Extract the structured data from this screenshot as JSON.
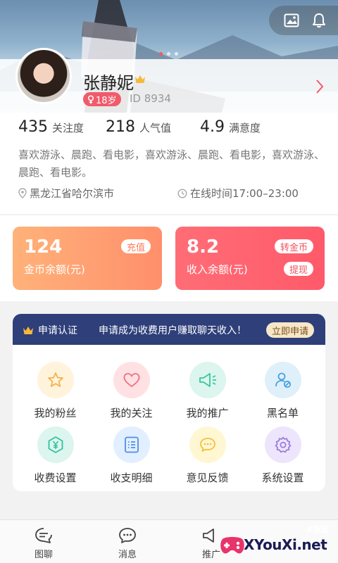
{
  "profile": {
    "name": "张静妮",
    "age_badge": "18岁",
    "id_text": "ID 8934"
  },
  "stats": [
    {
      "value": "435",
      "label": "关注度"
    },
    {
      "value": "218",
      "label": "人气值"
    },
    {
      "value": "4.9",
      "label": "满意度"
    }
  ],
  "bio": "喜欢游泳、晨跑、看电影，喜欢游泳、晨跑、看电影，喜欢游泳、晨跑、看电影。",
  "location": "黑龙江省哈尔滨市",
  "online_time": "在线时间17:00–23:00",
  "gold_card": {
    "value": "124",
    "label": "金币余额(元)",
    "button": "充值"
  },
  "income_card": {
    "value": "8.2",
    "label": "收入余额(元)",
    "button_top": "转金币",
    "button_bottom": "提现"
  },
  "apply_banner": {
    "title": "申请认证",
    "message": "申请成为收费用户赚取聊天收入！",
    "button": "立即申请"
  },
  "grid": [
    {
      "label": "我的粉丝",
      "icon": "star-icon",
      "bg": "#fff3dc",
      "color": "#f5b24a"
    },
    {
      "label": "我的关注",
      "icon": "heart-icon",
      "bg": "#ffe1e4",
      "color": "#f36f7e"
    },
    {
      "label": "我的推广",
      "icon": "megaphone-icon",
      "bg": "#dcf5ee",
      "color": "#36c7a0"
    },
    {
      "label": "黑名单",
      "icon": "block-user-icon",
      "bg": "#dff0fb",
      "color": "#4aa3e0"
    },
    {
      "label": "收费设置",
      "icon": "yuan-icon",
      "bg": "#dcf5ee",
      "color": "#34c29c"
    },
    {
      "label": "收支明细",
      "icon": "list-icon",
      "bg": "#e2efff",
      "color": "#4f8fe6"
    },
    {
      "label": "意见反馈",
      "icon": "chat-bubble-icon",
      "bg": "#fff7d2",
      "color": "#f0c13c"
    },
    {
      "label": "系统设置",
      "icon": "gear-icon",
      "bg": "#ece5fb",
      "color": "#9a77e0"
    }
  ],
  "tabs": [
    {
      "label": "图聊",
      "icon": "chat-lines-icon"
    },
    {
      "label": "消息",
      "icon": "message-icon"
    },
    {
      "label": "推广",
      "icon": "megaphone-icon"
    }
  ],
  "watermark": {
    "tag": "X游戏",
    "url": "XYouXi.net"
  }
}
